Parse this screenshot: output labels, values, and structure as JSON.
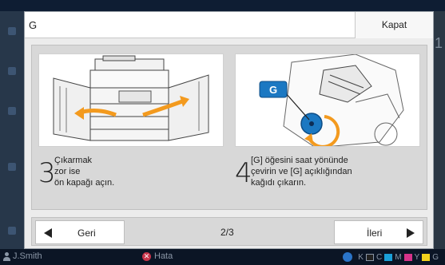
{
  "dialog": {
    "title": "G",
    "close_label": "Kapat"
  },
  "steps": [
    {
      "number": "3",
      "text": "Çıkarmak\nzor ise\nön kapağı açın."
    },
    {
      "number": "4",
      "text": "[G] öğesini saat yönünde\nçevirin ve [G] açıklığından\nkağıdı çıkarın."
    }
  ],
  "illustration": {
    "g_label": "G",
    "accent_orange": "#f39a1e",
    "accent_blue": "#1b78c2"
  },
  "nav": {
    "prev_label": "Geri",
    "next_label": "İleri",
    "page_indicator": "2/3"
  },
  "status_bar": {
    "user": "J.Smith",
    "error": "Hata",
    "inks": [
      "K",
      "C",
      "M",
      "Y",
      "G"
    ],
    "ink_colors": [
      "#222222",
      "#1aa0d8",
      "#d6338a",
      "#f2d21c",
      "#7a7a7a"
    ]
  },
  "background": {
    "right_number": "1"
  }
}
